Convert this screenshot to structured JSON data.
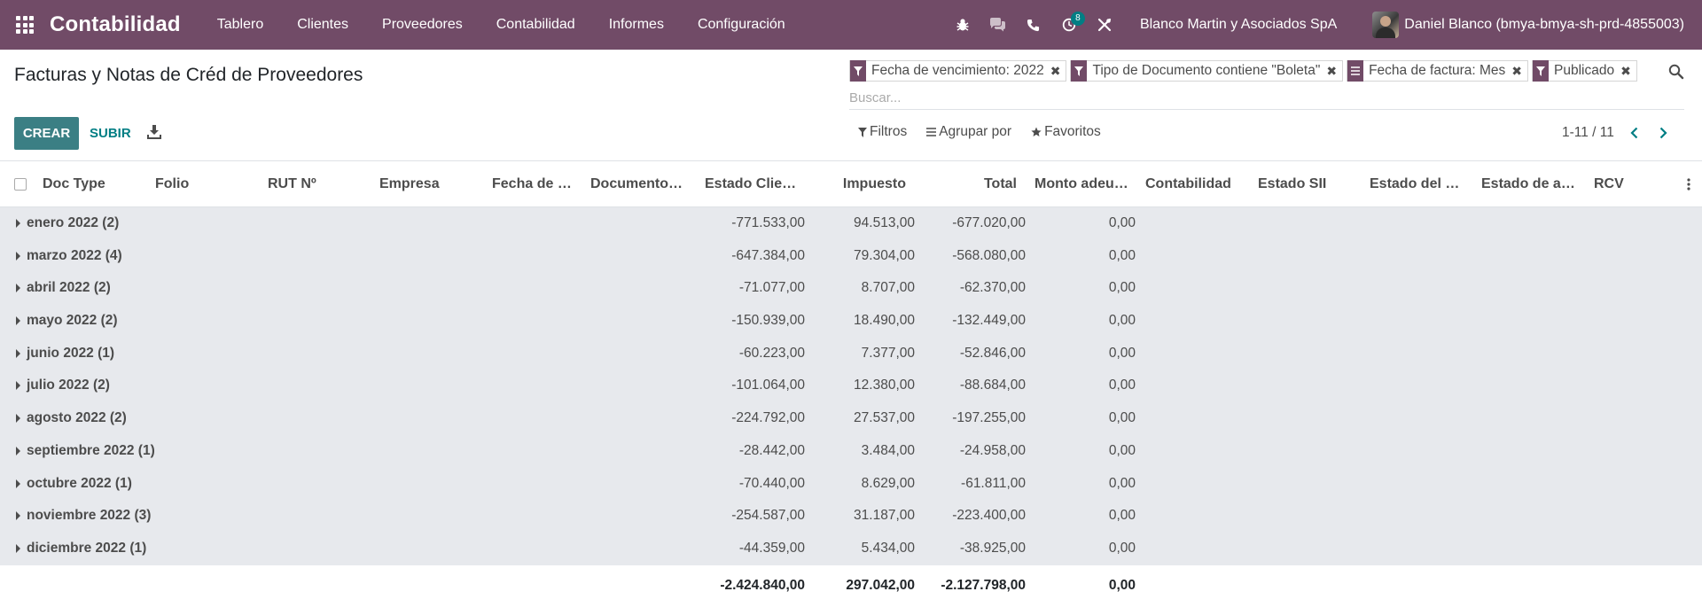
{
  "navbar": {
    "app_name": "Contabilidad",
    "menu": [
      "Tablero",
      "Clientes",
      "Proveedores",
      "Contabilidad",
      "Informes",
      "Configuración"
    ],
    "activity_count": "8",
    "company": "Blanco Martin y Asociados SpA",
    "user": "Daniel Blanco (bmya-bmya-sh-prd-4855003)",
    "color": "#714b67"
  },
  "control_panel": {
    "title": "Facturas y Notas de Créd de Proveedores",
    "create_label": "CREAR",
    "upload_label": "SUBIR",
    "facets": [
      {
        "icon": "filter-icon",
        "label": "Fecha de vencimiento: 2022"
      },
      {
        "icon": "filter-icon",
        "label": "Tipo de Documento contiene \"Boleta\""
      },
      {
        "icon": "group-icon",
        "label": "Fecha de factura: Mes"
      },
      {
        "icon": "filter-icon",
        "label": "Publicado"
      }
    ],
    "search_placeholder": "Buscar...",
    "filters_label": "Filtros",
    "group_by_label": "Agrupar por",
    "favorites_label": "Favoritos",
    "pager": "1-11 / 11"
  },
  "table": {
    "columns": [
      "Doc Type",
      "Folio",
      "RUT Nº",
      "Empresa",
      "Fecha de F...",
      "Documento o...",
      "Estado Cliente",
      "Impuesto",
      "Total",
      "Monto adeud...",
      "Contabilidad",
      "Estado SII",
      "Estado del D...",
      "Estado de ac...",
      "RCV"
    ],
    "groups": [
      {
        "label": "enero 2022 (2)",
        "estado_cliente": "-771.533,00",
        "impuesto": "94.513,00",
        "total": "-677.020,00",
        "monto": "0,00"
      },
      {
        "label": "marzo 2022 (4)",
        "estado_cliente": "-647.384,00",
        "impuesto": "79.304,00",
        "total": "-568.080,00",
        "monto": "0,00"
      },
      {
        "label": "abril 2022 (2)",
        "estado_cliente": "-71.077,00",
        "impuesto": "8.707,00",
        "total": "-62.370,00",
        "monto": "0,00"
      },
      {
        "label": "mayo 2022 (2)",
        "estado_cliente": "-150.939,00",
        "impuesto": "18.490,00",
        "total": "-132.449,00",
        "monto": "0,00"
      },
      {
        "label": "junio 2022 (1)",
        "estado_cliente": "-60.223,00",
        "impuesto": "7.377,00",
        "total": "-52.846,00",
        "monto": "0,00"
      },
      {
        "label": "julio 2022 (2)",
        "estado_cliente": "-101.064,00",
        "impuesto": "12.380,00",
        "total": "-88.684,00",
        "monto": "0,00"
      },
      {
        "label": "agosto 2022 (2)",
        "estado_cliente": "-224.792,00",
        "impuesto": "27.537,00",
        "total": "-197.255,00",
        "monto": "0,00"
      },
      {
        "label": "septiembre 2022 (1)",
        "estado_cliente": "-28.442,00",
        "impuesto": "3.484,00",
        "total": "-24.958,00",
        "monto": "0,00"
      },
      {
        "label": "octubre 2022 (1)",
        "estado_cliente": "-70.440,00",
        "impuesto": "8.629,00",
        "total": "-61.811,00",
        "monto": "0,00"
      },
      {
        "label": "noviembre 2022 (3)",
        "estado_cliente": "-254.587,00",
        "impuesto": "31.187,00",
        "total": "-223.400,00",
        "monto": "0,00"
      },
      {
        "label": "diciembre 2022 (1)",
        "estado_cliente": "-44.359,00",
        "impuesto": "5.434,00",
        "total": "-38.925,00",
        "monto": "0,00"
      }
    ],
    "totals": {
      "estado_cliente": "-2.424.840,00",
      "impuesto": "297.042,00",
      "total": "-2.127.798,00",
      "monto": "0,00"
    }
  }
}
